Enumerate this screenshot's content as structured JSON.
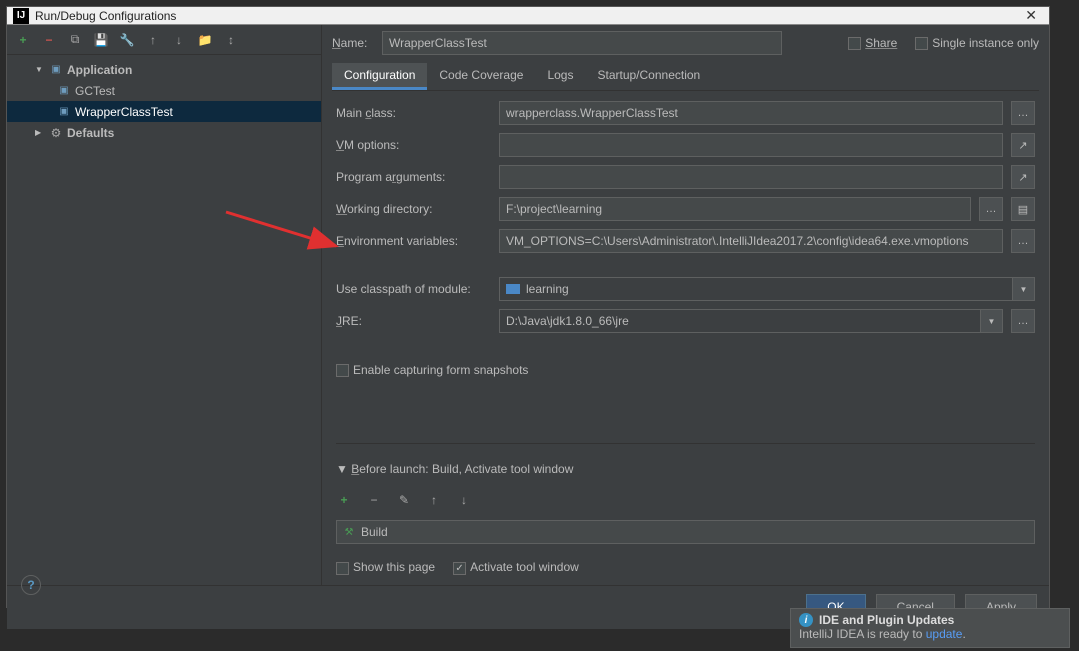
{
  "dialog": {
    "title": "Run/Debug Configurations"
  },
  "toolbar": {
    "add": "+",
    "remove": "−",
    "copy": "⧉",
    "save": "💾",
    "wrench": "🔧",
    "up": "↑",
    "down": "↓",
    "folder": "📁",
    "collapse": "↕"
  },
  "tree": {
    "application": "Application",
    "items": [
      {
        "label": "GCTest"
      },
      {
        "label": "WrapperClassTest"
      }
    ],
    "defaults": "Defaults"
  },
  "header": {
    "name_label": "Name:",
    "name_value": "WrapperClassTest",
    "share": "Share",
    "single_instance": "Single instance only"
  },
  "tabs": {
    "configuration": "Configuration",
    "code_coverage": "Code Coverage",
    "logs": "Logs",
    "startup": "Startup/Connection"
  },
  "form": {
    "main_class_label": "Main class:",
    "main_class_value": "wrapperclass.WrapperClassTest",
    "vm_options_label": "VM options:",
    "vm_options_value": "",
    "program_args_label": "Program arguments:",
    "program_args_value": "",
    "working_dir_label": "Working directory:",
    "working_dir_value": "F:\\project\\learning",
    "env_vars_label": "Environment variables:",
    "env_vars_value": "VM_OPTIONS=C:\\Users\\Administrator\\.IntelliJIdea2017.2\\config\\idea64.exe.vmoptions",
    "classpath_label": "Use classpath of module:",
    "classpath_value": "learning",
    "jre_label": "JRE:",
    "jre_value": "D:\\Java\\jdk1.8.0_66\\jre",
    "snapshots_label": "Enable capturing form snapshots"
  },
  "before_launch": {
    "title": "Before launch: Build, Activate tool window",
    "build": "Build",
    "show_page": "Show this page",
    "activate": "Activate tool window"
  },
  "buttons": {
    "ok": "OK",
    "cancel": "Cancel",
    "apply": "Apply"
  },
  "notification": {
    "title": "IDE and Plugin Updates",
    "body_prefix": "IntelliJ IDEA is ready to ",
    "link": "update",
    "body_suffix": "."
  }
}
